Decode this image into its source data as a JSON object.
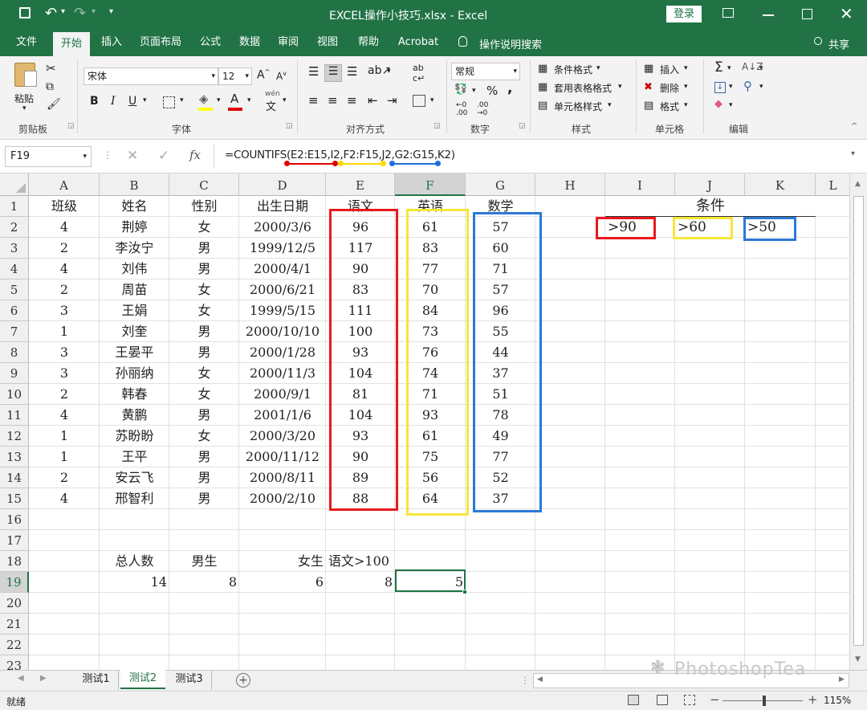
{
  "window": {
    "title": "EXCEL操作小技巧.xlsx  -  Excel",
    "login": "登录",
    "share": "共享",
    "tell_me": "操作说明搜索"
  },
  "tabs": [
    "文件",
    "开始",
    "插入",
    "页面布局",
    "公式",
    "数据",
    "审阅",
    "视图",
    "帮助",
    "Acrobat"
  ],
  "ribbon": {
    "clipboard": {
      "paste": "粘贴",
      "label": "剪贴板"
    },
    "font": {
      "name": "宋体",
      "size": "12",
      "label": "字体",
      "bold": "B",
      "italic": "I",
      "underline": "U",
      "wen": "文"
    },
    "alignment": {
      "label": "对齐方式"
    },
    "number": {
      "format": "常规",
      "label": "数字",
      "percent": "%",
      "comma": ","
    },
    "styles": {
      "cond": "条件格式",
      "table": "套用表格格式",
      "cell": "单元格样式",
      "label": "样式"
    },
    "cells": {
      "insert": "插入",
      "delete": "删除",
      "format": "格式",
      "label": "单元格"
    },
    "editing": {
      "label": "编辑"
    }
  },
  "formula_bar": {
    "name_box": "F19",
    "fx": "fx",
    "formula": "=COUNTIFS(E2:E15,I2,F2:F15,J2,G2:G15,K2)"
  },
  "columns": [
    "A",
    "B",
    "C",
    "D",
    "E",
    "F",
    "G",
    "H",
    "I",
    "J",
    "K",
    "L"
  ],
  "rows": [
    "1",
    "2",
    "3",
    "4",
    "5",
    "6",
    "7",
    "8",
    "9",
    "10",
    "11",
    "12",
    "13",
    "14",
    "15",
    "16",
    "17",
    "18",
    "19",
    "20",
    "21",
    "22",
    "23"
  ],
  "headers": [
    "班级",
    "姓名",
    "性别",
    "出生日期",
    "语文",
    "英语",
    "数学"
  ],
  "criteria": {
    "title": "条件",
    "i2": ">90",
    "j2": ">60",
    "k2": ">50"
  },
  "table": [
    [
      "4",
      "荆婷",
      "女",
      "2000/3/6",
      "96",
      "61",
      "57"
    ],
    [
      "2",
      "李汝宁",
      "男",
      "1999/12/5",
      "117",
      "83",
      "60"
    ],
    [
      "4",
      "刘伟",
      "男",
      "2000/4/1",
      "90",
      "77",
      "71"
    ],
    [
      "2",
      "周苗",
      "女",
      "2000/6/21",
      "83",
      "70",
      "57"
    ],
    [
      "3",
      "王娟",
      "女",
      "1999/5/15",
      "111",
      "84",
      "96"
    ],
    [
      "1",
      "刘奎",
      "男",
      "2000/10/10",
      "100",
      "73",
      "55"
    ],
    [
      "3",
      "王晏平",
      "男",
      "2000/1/28",
      "93",
      "76",
      "44"
    ],
    [
      "3",
      "孙丽纳",
      "女",
      "2000/11/3",
      "104",
      "74",
      "37"
    ],
    [
      "2",
      "韩春",
      "女",
      "2000/9/1",
      "81",
      "71",
      "51"
    ],
    [
      "4",
      "黄鹏",
      "男",
      "2001/1/6",
      "104",
      "93",
      "78"
    ],
    [
      "1",
      "苏盼盼",
      "女",
      "2000/3/20",
      "93",
      "61",
      "49"
    ],
    [
      "1",
      "王平",
      "男",
      "2000/11/12",
      "90",
      "75",
      "77"
    ],
    [
      "2",
      "安云飞",
      "男",
      "2000/8/11",
      "89",
      "56",
      "52"
    ],
    [
      "4",
      "邢智利",
      "男",
      "2000/2/10",
      "88",
      "64",
      "37"
    ]
  ],
  "summary": {
    "labels": [
      "总人数",
      "男生",
      "女生",
      "语文>100"
    ],
    "values": [
      "14",
      "8",
      "6",
      "8",
      "5"
    ]
  },
  "sheets": [
    "测试1",
    "测试2",
    "测试3"
  ],
  "status": {
    "ready": "就绪",
    "zoom": "115%"
  },
  "watermark": "PhotoshopTea"
}
